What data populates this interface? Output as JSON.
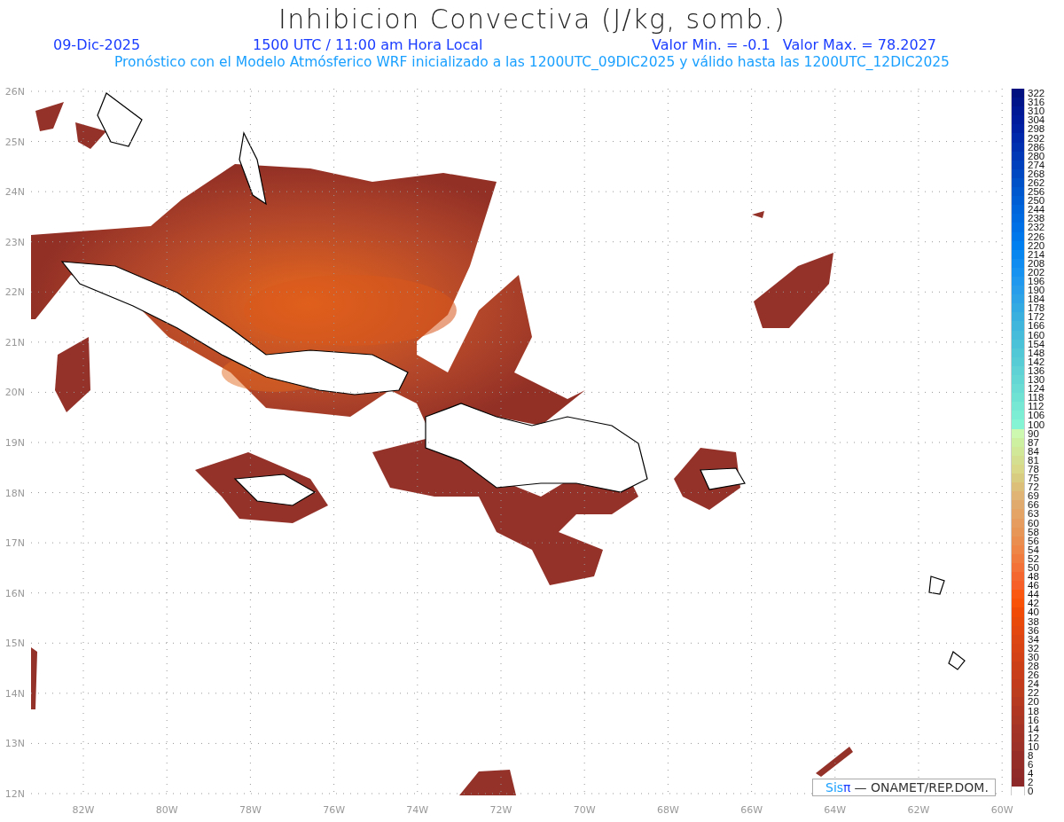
{
  "title": "Inhibicion Convectiva (J/kg, somb.)",
  "info": {
    "date": "09-Dic-2025",
    "time": "1500 UTC / 11:00 am Hora Local",
    "min": "Valor Min. = -0.1",
    "max": "Valor Max. = 78.2027"
  },
  "subtitle": "Pronóstico con el Modelo Atmósferico WRF inicializado a las 1200UTC_09DIC2025 y válido hasta las  1200UTC_12DIC2025",
  "map": {
    "lat_labels": [
      "26N",
      "25N",
      "24N",
      "23N",
      "22N",
      "21N",
      "20N",
      "19N",
      "18N",
      "17N",
      "16N",
      "15N",
      "14N",
      "13N",
      "12N"
    ],
    "lon_labels": [
      "82W",
      "80W",
      "78W",
      "76W",
      "74W",
      "72W",
      "70W",
      "68W",
      "66W",
      "64W",
      "62W",
      "60W"
    ],
    "credit": {
      "brand": "Sis",
      "symbol": "π",
      "agency": "— ONAMET/REP.DOM."
    }
  },
  "legend": [
    {
      "label": "322",
      "color": "#00107f"
    },
    {
      "label": "316",
      "color": "#00148a"
    },
    {
      "label": "310",
      "color": "#001894"
    },
    {
      "label": "304",
      "color": "#001c9c"
    },
    {
      "label": "298",
      "color": "#0020a4"
    },
    {
      "label": "292",
      "color": "#0028aa"
    },
    {
      "label": "286",
      "color": "#0030b0"
    },
    {
      "label": "280",
      "color": "#0038b6"
    },
    {
      "label": "274",
      "color": "#0040bc"
    },
    {
      "label": "268",
      "color": "#0048c2"
    },
    {
      "label": "262",
      "color": "#0050c8"
    },
    {
      "label": "256",
      "color": "#0058ce"
    },
    {
      "label": "250",
      "color": "#005ed4"
    },
    {
      "label": "244",
      "color": "#0064da"
    },
    {
      "label": "238",
      "color": "#006ae0"
    },
    {
      "label": "232",
      "color": "#0070e6"
    },
    {
      "label": "226",
      "color": "#0078ec"
    },
    {
      "label": "220",
      "color": "#0080f0"
    },
    {
      "label": "214",
      "color": "#0886f0"
    },
    {
      "label": "208",
      "color": "#108cf0"
    },
    {
      "label": "202",
      "color": "#1892f0"
    },
    {
      "label": "196",
      "color": "#2098ee"
    },
    {
      "label": "190",
      "color": "#289eea"
    },
    {
      "label": "184",
      "color": "#2ea4e6"
    },
    {
      "label": "178",
      "color": "#34aae2"
    },
    {
      "label": "172",
      "color": "#3ab0de"
    },
    {
      "label": "166",
      "color": "#40b6dc"
    },
    {
      "label": "160",
      "color": "#46bcda"
    },
    {
      "label": "154",
      "color": "#4cc2d8"
    },
    {
      "label": "148",
      "color": "#52c8d6"
    },
    {
      "label": "142",
      "color": "#58ccd4"
    },
    {
      "label": "136",
      "color": "#5ed2d4"
    },
    {
      "label": "130",
      "color": "#64d6d4"
    },
    {
      "label": "124",
      "color": "#6adcd4"
    },
    {
      "label": "118",
      "color": "#70e2d4"
    },
    {
      "label": "112",
      "color": "#76e8d4"
    },
    {
      "label": "106",
      "color": "#7ceed4"
    },
    {
      "label": "100",
      "color": "#84f4d4"
    },
    {
      "label": "90",
      "color": "#ccf8b0"
    },
    {
      "label": "87",
      "color": "#ccf0a0"
    },
    {
      "label": "84",
      "color": "#d0e898"
    },
    {
      "label": "81",
      "color": "#d4e090"
    },
    {
      "label": "78",
      "color": "#d8d888"
    },
    {
      "label": "75",
      "color": "#d8cc80"
    },
    {
      "label": "72",
      "color": "#dcc07a"
    },
    {
      "label": "69",
      "color": "#e0b474"
    },
    {
      "label": "66",
      "color": "#e0aa6e"
    },
    {
      "label": "63",
      "color": "#e4a466"
    },
    {
      "label": "60",
      "color": "#e69c5e"
    },
    {
      "label": "58",
      "color": "#e89658"
    },
    {
      "label": "56",
      "color": "#ea8e50"
    },
    {
      "label": "54",
      "color": "#ee8648"
    },
    {
      "label": "52",
      "color": "#f07c40"
    },
    {
      "label": "50",
      "color": "#f27238"
    },
    {
      "label": "48",
      "color": "#f46830"
    },
    {
      "label": "46",
      "color": "#f66028"
    },
    {
      "label": "44",
      "color": "#fa5810"
    },
    {
      "label": "42",
      "color": "#f85208"
    },
    {
      "label": "40",
      "color": "#f04c08"
    },
    {
      "label": "38",
      "color": "#e84a0c"
    },
    {
      "label": "36",
      "color": "#e24810"
    },
    {
      "label": "34",
      "color": "#dc4612"
    },
    {
      "label": "32",
      "color": "#d84414"
    },
    {
      "label": "30",
      "color": "#d24216"
    },
    {
      "label": "28",
      "color": "#cc4018"
    },
    {
      "label": "26",
      "color": "#c83e1a"
    },
    {
      "label": "24",
      "color": "#c23c1c"
    },
    {
      "label": "22",
      "color": "#bc3c1e"
    },
    {
      "label": "20",
      "color": "#b63a20"
    },
    {
      "label": "18",
      "color": "#b03822"
    },
    {
      "label": "16",
      "color": "#aa3624"
    },
    {
      "label": "14",
      "color": "#a43426"
    },
    {
      "label": "12",
      "color": "#a03226"
    },
    {
      "label": "10",
      "color": "#9c3228"
    },
    {
      "label": "8",
      "color": "#982e28"
    },
    {
      "label": "6",
      "color": "#942c28"
    },
    {
      "label": "4",
      "color": "#902a28"
    },
    {
      "label": "2",
      "color": "#8c2828"
    },
    {
      "label": "0",
      "color": "#ffffff"
    }
  ]
}
